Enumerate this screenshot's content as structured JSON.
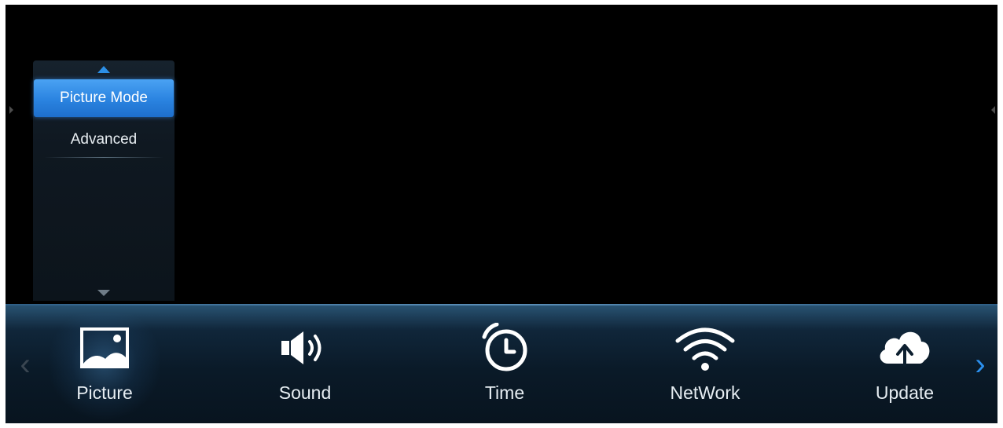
{
  "side_menu": {
    "items": [
      {
        "label": "Picture Mode",
        "selected": true
      },
      {
        "label": "Advanced",
        "selected": false
      }
    ]
  },
  "bottom_nav": {
    "tabs": [
      {
        "label": "Picture",
        "icon": "picture-icon",
        "active": true
      },
      {
        "label": "Sound",
        "icon": "speaker-icon",
        "active": false
      },
      {
        "label": "Time",
        "icon": "clock-icon",
        "active": false
      },
      {
        "label": "NetWork",
        "icon": "wifi-icon",
        "active": false
      },
      {
        "label": "Update",
        "icon": "cloud-upload-icon",
        "active": false
      }
    ],
    "prev_arrow": "‹",
    "next_arrow": "›"
  },
  "colors": {
    "accent": "#2a83e0",
    "background": "#000000",
    "bar_top": "#2a5575",
    "text": "#e6edf2"
  }
}
